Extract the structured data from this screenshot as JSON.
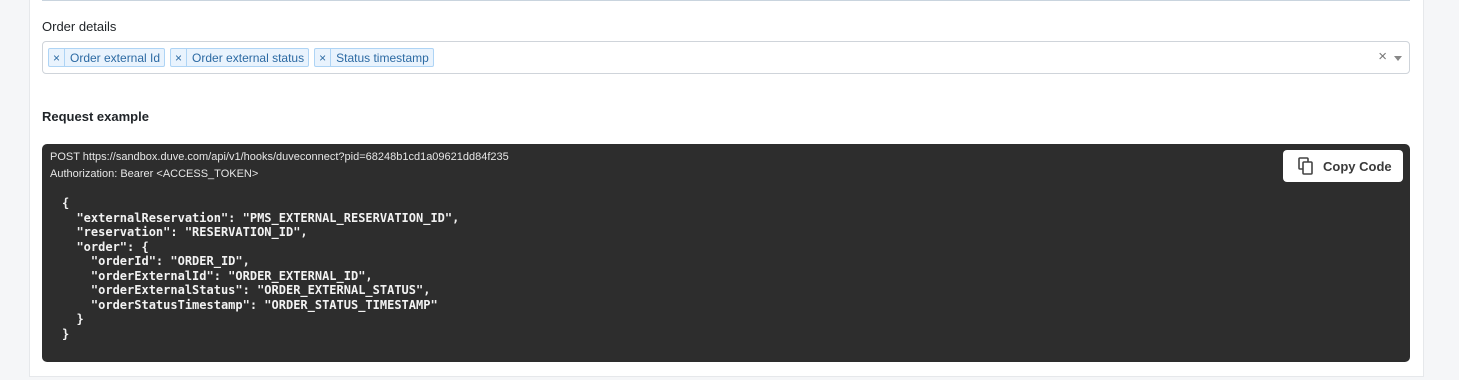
{
  "order_details": {
    "label": "Order details",
    "selected_tags": [
      {
        "remove_symbol": "×",
        "label": "Order external Id"
      },
      {
        "remove_symbol": "×",
        "label": "Order external status"
      },
      {
        "remove_symbol": "×",
        "label": "Status timestamp"
      }
    ],
    "clear_symbol": "×",
    "dropdown_icon": "chevron-down-icon"
  },
  "request_example": {
    "title": "Request example",
    "request_line": "POST https://sandbox.duve.com/api/v1/hooks/duveconnect?pid=68248b1cd1a09621dd84f235",
    "auth_line": "Authorization: Bearer <ACCESS_TOKEN>",
    "body": "{\n  \"externalReservation\": \"PMS_EXTERNAL_RESERVATION_ID\",\n  \"reservation\": \"RESERVATION_ID\",\n  \"order\": {\n    \"orderId\": \"ORDER_ID\",\n    \"orderExternalId\": \"ORDER_EXTERNAL_ID\",\n    \"orderExternalStatus\": \"ORDER_EXTERNAL_STATUS\",\n    \"orderStatusTimestamp\": \"ORDER_STATUS_TIMESTAMP\"\n  }\n}",
    "copy_button": {
      "icon": "copy-icon",
      "label": "Copy Code"
    }
  },
  "colors": {
    "code_background": "#2d2d2d",
    "tag_background": "#e9f3fd",
    "tag_text": "#2c6aa3"
  }
}
